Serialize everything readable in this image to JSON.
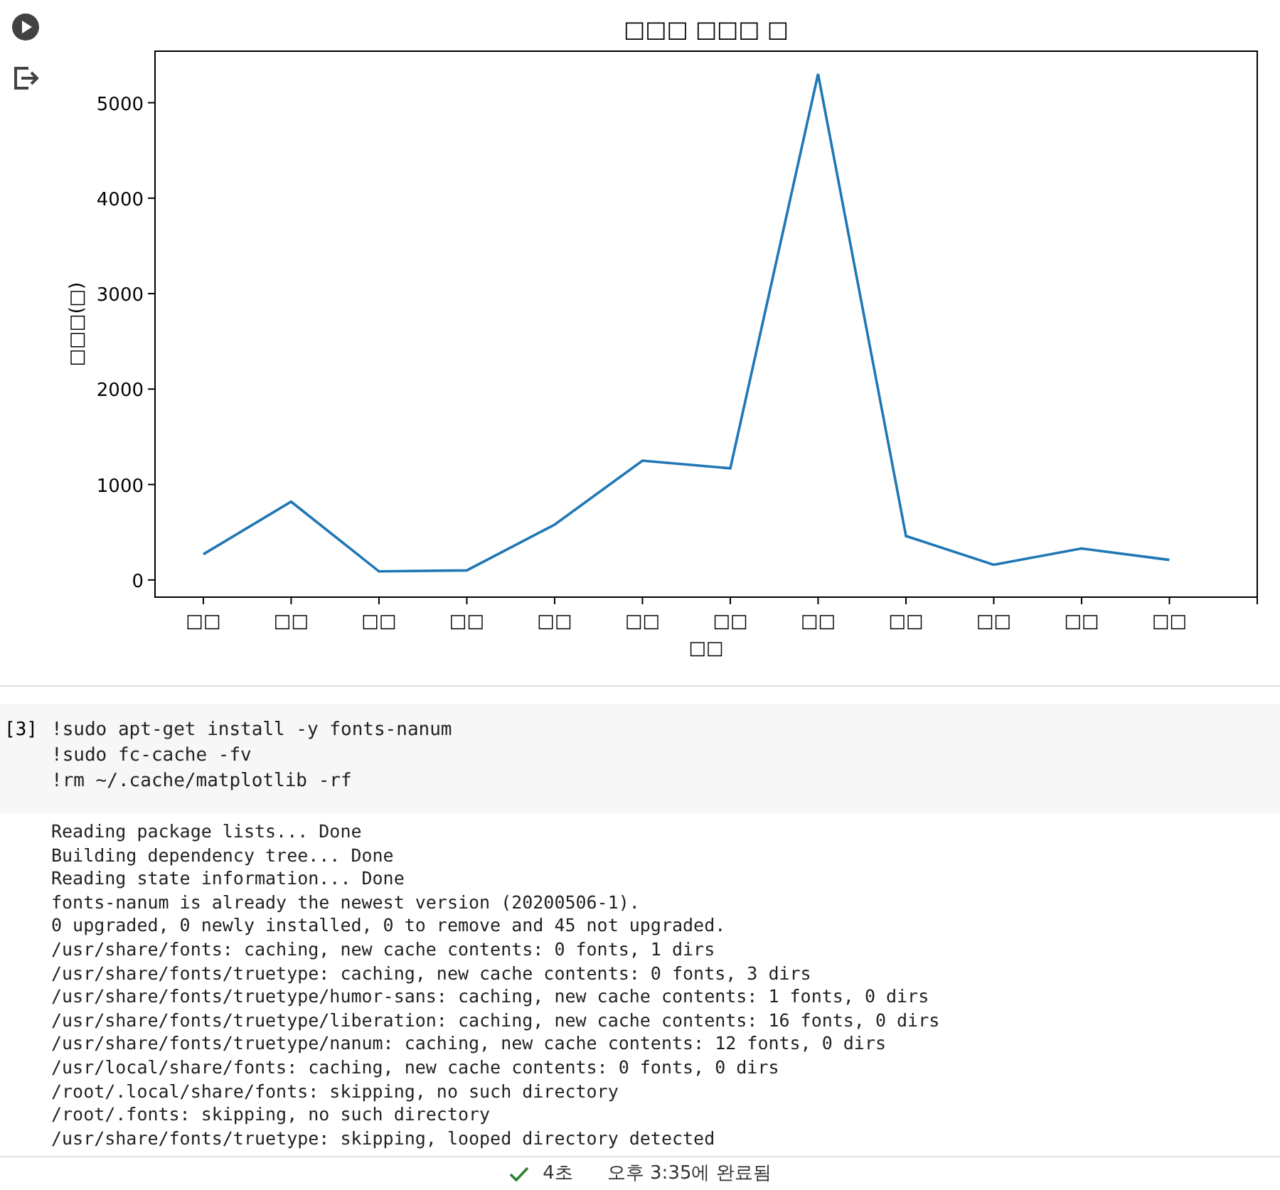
{
  "chart_cell": {
    "chart_data": {
      "type": "line",
      "title": "□□□ □□□ □",
      "xlabel": "□□",
      "ylabel": "□□□(□)",
      "categories": [
        "□□",
        "□□",
        "□□",
        "□□",
        "□□",
        "□□",
        "□□",
        "□□",
        "□□",
        "□□",
        "□□",
        "□□"
      ],
      "series": [
        {
          "color": "#1f77b4",
          "values": [
            270,
            820,
            90,
            100,
            580,
            1250,
            1170,
            5300,
            460,
            160,
            330,
            210
          ]
        }
      ],
      "ylim": [
        -180,
        5540
      ],
      "yticks": [
        0,
        1000,
        2000,
        3000,
        4000,
        5000
      ]
    }
  },
  "code_cell": {
    "execution_count": "[3]",
    "lines": [
      "!sudo apt-get install -y fonts-nanum",
      "!sudo fc-cache -fv",
      "!rm ~/.cache/matplotlib -rf"
    ],
    "output": [
      "Reading package lists... Done",
      "Building dependency tree... Done",
      "Reading state information... Done",
      "fonts-nanum is already the newest version (20200506-1).",
      "0 upgraded, 0 newly installed, 0 to remove and 45 not upgraded.",
      "/usr/share/fonts: caching, new cache contents: 0 fonts, 1 dirs",
      "/usr/share/fonts/truetype: caching, new cache contents: 0 fonts, 3 dirs",
      "/usr/share/fonts/truetype/humor-sans: caching, new cache contents: 1 fonts, 0 dirs",
      "/usr/share/fonts/truetype/liberation: caching, new cache contents: 16 fonts, 0 dirs",
      "/usr/share/fonts/truetype/nanum: caching, new cache contents: 12 fonts, 0 dirs",
      "/usr/local/share/fonts: caching, new cache contents: 0 fonts, 0 dirs",
      "/root/.local/share/fonts: skipping, no such directory",
      "/root/.fonts: skipping, no such directory",
      "/usr/share/fonts/truetype: skipping, looped directory detected"
    ]
  },
  "status_bar": {
    "duration": "4초",
    "completed": "오후 3:35에 완료됨"
  }
}
